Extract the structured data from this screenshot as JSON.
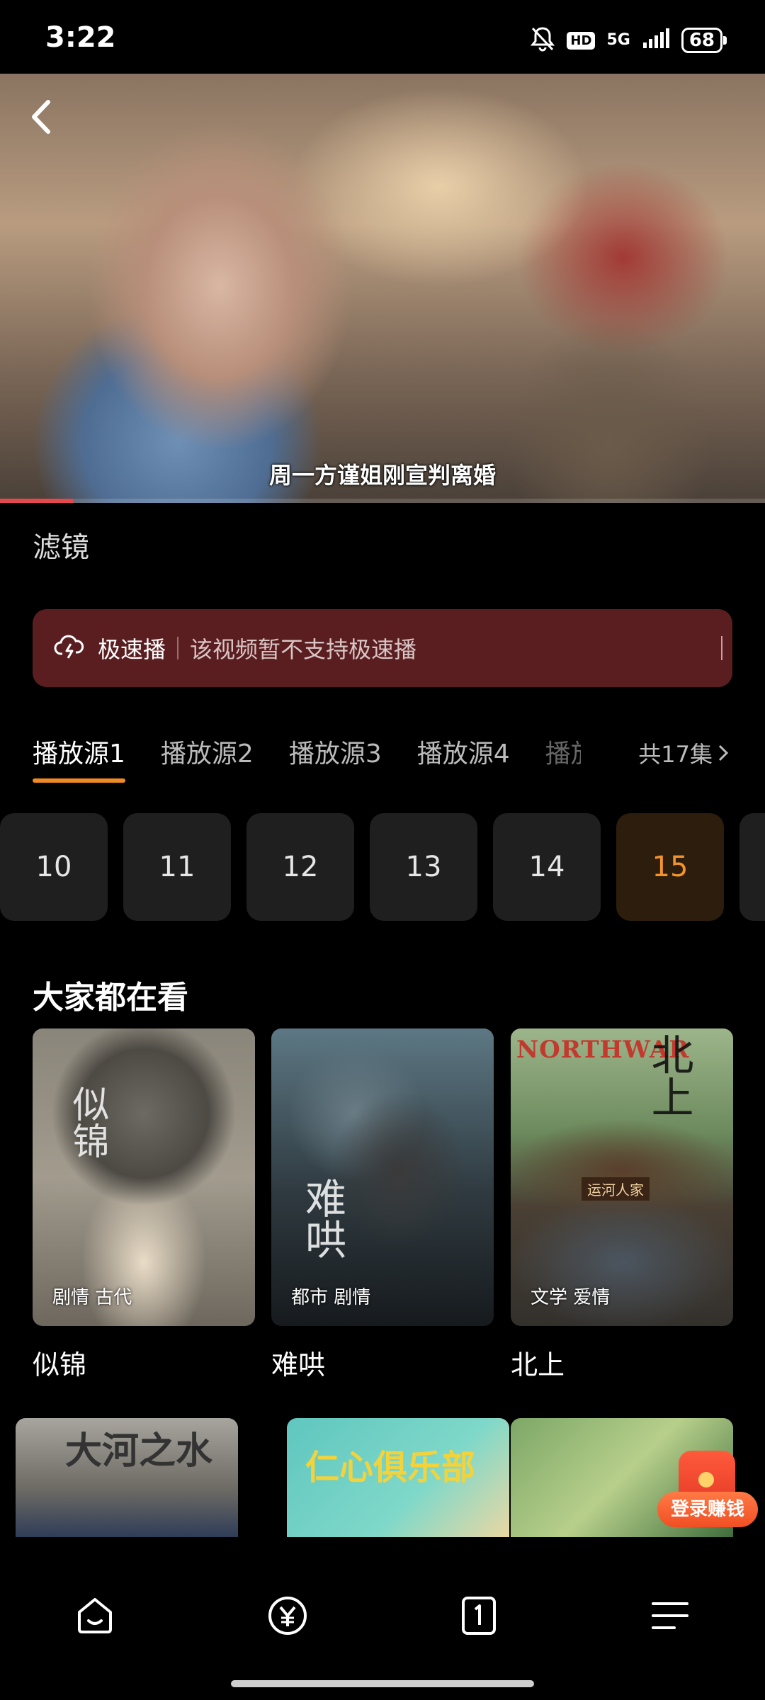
{
  "status_bar": {
    "time": "3:22",
    "hd": "HD",
    "network": "5G",
    "battery": "68"
  },
  "player": {
    "subtitle": "周一方谨姐刚宣判离婚",
    "progress_fraction": 0.095
  },
  "filter_label": "滤镜",
  "speed_banner": {
    "title": "极速播",
    "message": "该视频暂不支持极速播"
  },
  "source_tabs": [
    {
      "label": "播放源1"
    },
    {
      "label": "播放源2"
    },
    {
      "label": "播放源3"
    },
    {
      "label": "播放源4"
    },
    {
      "label": "播放"
    }
  ],
  "episode_total": "共17集",
  "episodes": [
    "10",
    "11",
    "12",
    "13",
    "14",
    "15"
  ],
  "current_episode": "15",
  "section": {
    "title": "大家都在看",
    "cards": [
      {
        "title": "似锦",
        "tags": "剧情 古代"
      },
      {
        "title": "难哄",
        "tags": "都市 剧情"
      },
      {
        "title": "北上",
        "tags": "文学 爱情"
      }
    ]
  },
  "posters_text": {
    "card1_calligraphy": "似锦",
    "card2_calligraphy": "难哄",
    "card3_brand": "NORTHWAR",
    "card3_calligraphy": "北上",
    "card3_sign": "运河人家",
    "row2_a": "大河之水",
    "row2_b": "仁心俱乐部"
  },
  "login_badge": "登录赚钱",
  "colors": {
    "accent": "#f08a24",
    "banner_bg": "#5a1e20",
    "progress": "#e5484d"
  }
}
